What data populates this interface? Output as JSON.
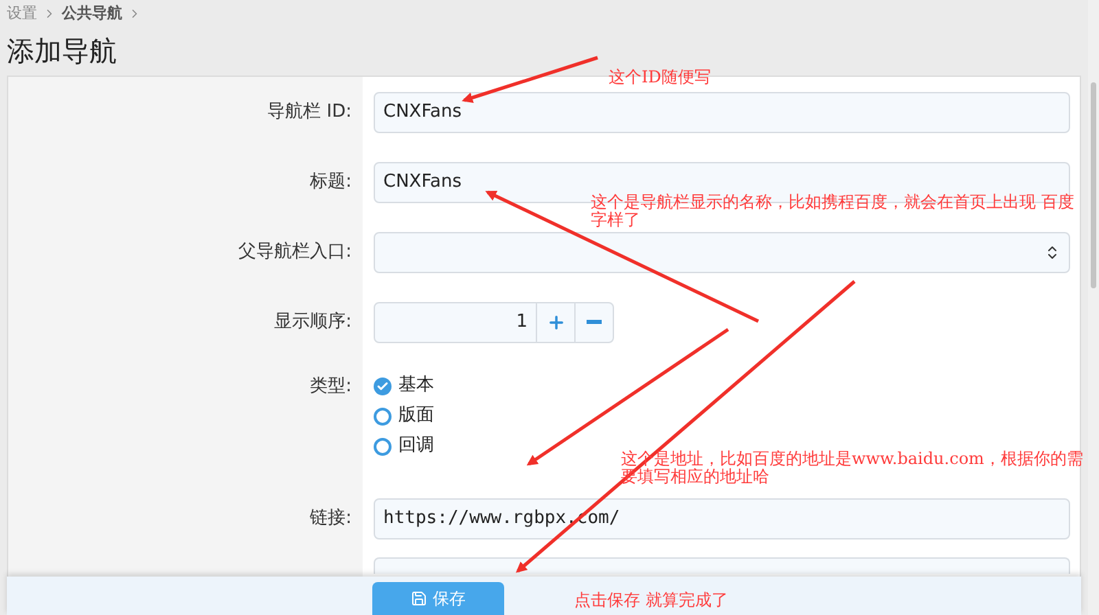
{
  "breadcrumb": [
    {
      "label": "设置",
      "current": false
    },
    {
      "label": "公共导航",
      "current": true
    }
  ],
  "title": "添加导航",
  "rows": [
    {
      "kind": "text",
      "label": "导航栏 ID:",
      "value": "CNXFans"
    },
    {
      "kind": "text",
      "label": "标题:",
      "value": "CNXFans"
    },
    {
      "kind": "select",
      "label": "父导航栏入口:"
    },
    {
      "kind": "number",
      "label": "显示顺序:",
      "value": "1"
    },
    {
      "kind": "radio",
      "label": "类型:",
      "options": [
        {
          "label": "基本",
          "selected": true
        },
        {
          "label": "版面",
          "selected": false
        },
        {
          "label": "回调",
          "selected": false
        }
      ]
    },
    {
      "kind": "url",
      "label": "链接:",
      "value": "https://www.rgbpx.com/"
    },
    {
      "kind": "text"
    }
  ],
  "save_button": "保存",
  "annotations": [
    {
      "text": "这个ID随便写"
    },
    {
      "text": "这个是导航栏显示的名称，比如携程百度，就会在首页上出现 百度字样了"
    },
    {
      "text": "这个是地址，比如百度的地址是www.baidu.com，根据你的需要填写相应的地址哈"
    },
    {
      "text": "点击保存 就算完成了"
    }
  ]
}
